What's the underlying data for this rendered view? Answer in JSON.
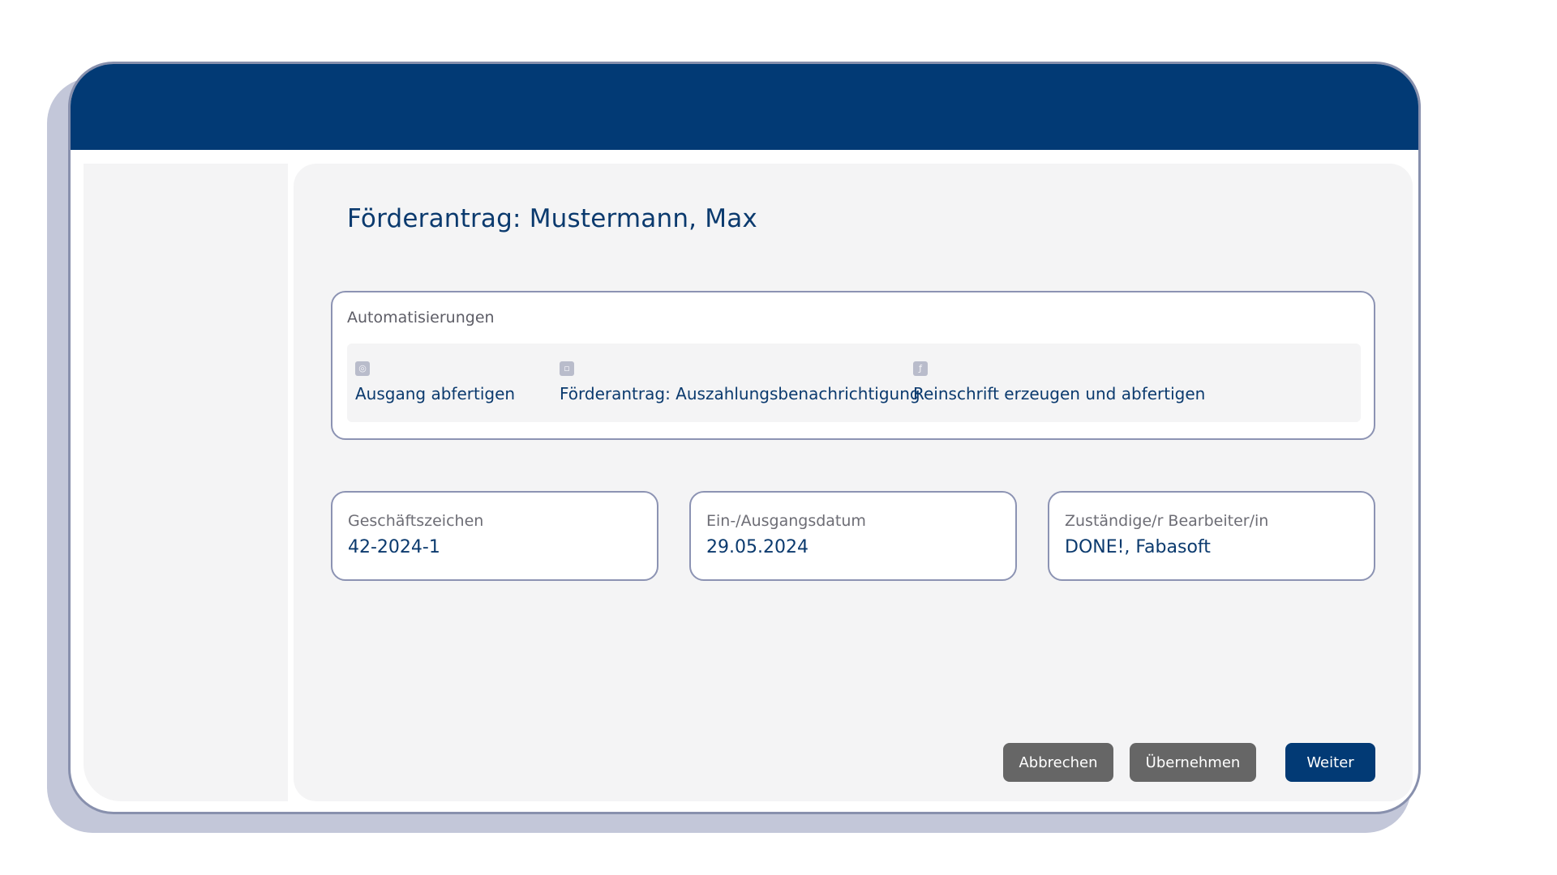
{
  "page": {
    "title": "Förderantrag: Mustermann, Max"
  },
  "automations": {
    "label": "Automatisierungen",
    "items": [
      {
        "label": "Ausgang abfertigen",
        "icon": "dispatch-icon"
      },
      {
        "label": "Förderantrag:  Auszahlungsbenachrichtigung",
        "icon": "document-icon"
      },
      {
        "label": "Reinschrift erzeugen und abfertigen",
        "icon": "clean-copy-icon"
      }
    ]
  },
  "fields": [
    {
      "label": "Geschäftszeichen",
      "value": "42-2024-1"
    },
    {
      "label": "Ein-/Ausgangsdatum",
      "value": "29.05.2024"
    },
    {
      "label": "Zuständige/r Bearbeiter/in",
      "value": "DONE!, Fabasoft"
    }
  ],
  "actions": {
    "cancel_label": "Abbrechen",
    "apply_label": "Übernehmen",
    "next_label": "Weiter"
  },
  "colors": {
    "brand": "#023a75",
    "secondary_button": "#666666",
    "panel_background": "#f4f4f5",
    "border": "#8c93b3"
  }
}
